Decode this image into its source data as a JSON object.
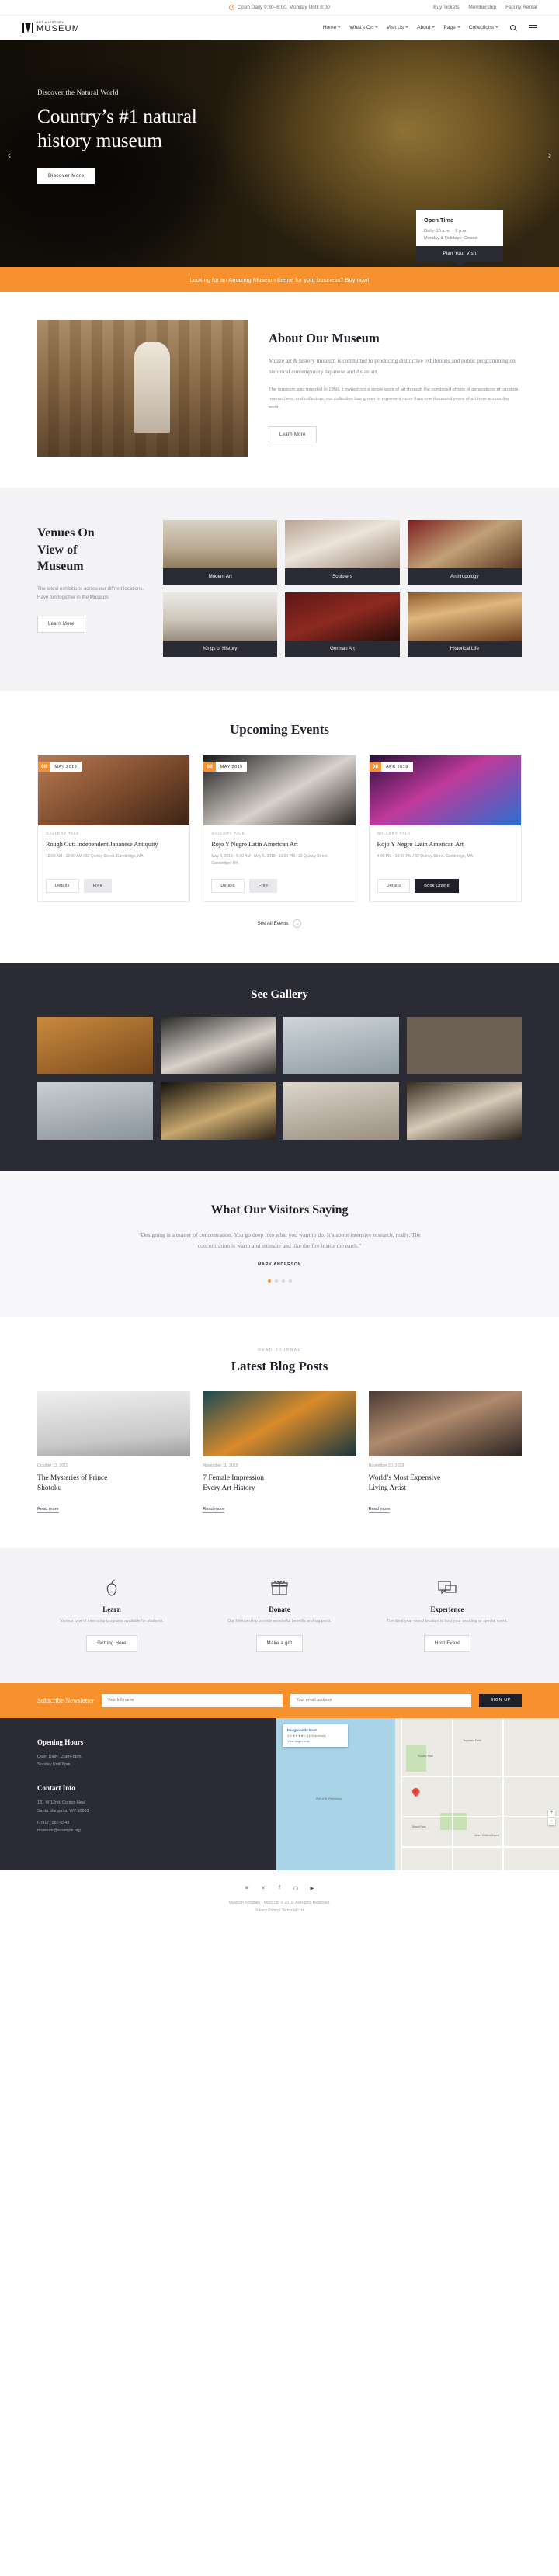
{
  "topbar": {
    "hours": "Open Daily 9:30–6:00, Monday Until 8:00",
    "links": [
      "Buy Tickets",
      "Membership",
      "Facility Rental"
    ]
  },
  "header": {
    "logo_sub": "ART & HISTORY",
    "logo_main": "MUSEUM",
    "nav": [
      "Home",
      "What's On",
      "Visit Us",
      "About",
      "Page",
      "Collections"
    ],
    "search_icon": "search-icon",
    "menu_icon": "hamburger-icon"
  },
  "hero": {
    "kicker": "Discover the Natural World",
    "title_line1": "Country’s #1 natural",
    "title_line2": "history museum",
    "cta": "Discover More",
    "prev_icon": "chevron-left-icon",
    "next_icon": "chevron-right-icon",
    "open_card": {
      "title": "Open Time",
      "line1": "Daily: 10 a.m. – 5 p.m.",
      "line2": "Monday & Holidays: Closed",
      "button": "Plan Your Visit"
    }
  },
  "promo": {
    "text": "Looking for an Amazing Museum theme for your business? Buy now!"
  },
  "about": {
    "heading": "About Our Museum",
    "lead": "Muzze art & history museum is committed to producing distinctive exhibitions and public programming on historical contemporary Japanese and Asian art.",
    "body": "The museum was founded in 1950, it owned not a single work of art through the combined efforts of generations of curators, researchers, and collectors, our collection has grown to represent more than one thousand years of art from across the world.",
    "button": "Learn More"
  },
  "venues": {
    "heading_line1": "Venues On",
    "heading_line2": "View of",
    "heading_line3": "Museum",
    "desc": "The latest exhibitions across our diffrent locations. Have fun together in the Museum.",
    "button": "Learn More",
    "cards": [
      {
        "label": "Modern Art"
      },
      {
        "label": "Sculpters"
      },
      {
        "label": "Anthropology"
      },
      {
        "label": "Kings of History"
      },
      {
        "label": "German Art"
      },
      {
        "label": "Historical Life"
      }
    ]
  },
  "events": {
    "heading": "Upcoming Events",
    "see_all": "See All Events",
    "see_all_icon": "arrow-right-icon",
    "items": [
      {
        "day": "08",
        "month": "MAY 2019",
        "category": "GALLERY TALK",
        "title": "Rough Cut: Independent Japanese Antiquity",
        "meta": "12:00 AM - 12:00 AM / 32 Quincy Street, Cambridge, MA",
        "btn1": "Details",
        "btn2": "Free",
        "btn2_style": "free"
      },
      {
        "day": "08",
        "month": "MAY 2019",
        "category": "GALLERY TALK",
        "title": "Rojo Y Negro Latin American Art",
        "meta": "May 8, 2019 - 5:00 AM - May 5, 2019 - 11:00 PM / 32 Quincy Street, Cambridge, MA",
        "btn1": "Details",
        "btn2": "Free",
        "btn2_style": "free"
      },
      {
        "day": "08",
        "month": "APR 2019",
        "category": "GALLERY TALK",
        "title": "Rojo Y Negro Latin American Art",
        "meta": "4:00 PM - 10:00 PM / 32 Quincy Street, Cambridge, MA",
        "btn1": "Details",
        "btn2": "Book Online",
        "btn2_style": "dark"
      }
    ]
  },
  "gallery": {
    "heading": "See Gallery",
    "cell_count": 8
  },
  "testimonial": {
    "heading": "What Our Visitors Saying",
    "quote": "“Designing is a matter of concentration. You go deep into what you want to do. It’s about intensive research, really. The concentration is warm and intimate and like the fire inside the earth.”",
    "author": "MARK ANDERSON",
    "dot_count": 4,
    "active_dot": 0
  },
  "blog": {
    "kicker": "READ JOURNAL",
    "heading": "Latest Blog Posts",
    "posts": [
      {
        "date": "October 13, 2019",
        "title_line1": "The Mysteries of Prince",
        "title_line2": "Shotoku",
        "more": "Read more"
      },
      {
        "date": "November 11, 2019",
        "title_line1": "7 Female Impression",
        "title_line2": "Every Art History",
        "more": "Read more"
      },
      {
        "date": "November 20, 2019",
        "title_line1": "World’s Most Expensive",
        "title_line2": "Living Artist",
        "more": "Read more"
      }
    ]
  },
  "features": [
    {
      "icon": "apple-icon",
      "title": "Learn",
      "desc": "Various type of internship programs available for students.",
      "button": "Getting Here"
    },
    {
      "icon": "gift-icon",
      "title": "Donate",
      "desc": "Our Membership provide wonderful benefits and supports.",
      "button": "Make a gift"
    },
    {
      "icon": "chat-icon",
      "title": "Experience",
      "desc": "The ideal year-round location to host your wedding or special event.",
      "button": "Host Event"
    }
  ],
  "newsletter": {
    "title": "Subscribe Newsletter",
    "name_placeholder": "Your full name",
    "email_placeholder": "Your email address",
    "button": "SIGN UP"
  },
  "footer": {
    "hours_title": "Opening Hours",
    "hours_lines": [
      "Open Daily, 10am–6pm.",
      "Sunday Until 8pm"
    ],
    "contact_title": "Contact Info",
    "contact_lines": [
      "131 W 12nd, Conton Heal",
      "Santa Margarita, WV 50663",
      "",
      "t. (917) 987-6543",
      "museum@example.org"
    ],
    "map": {
      "card_title": "Fairgrounds East",
      "card_sub": "4.5 ★★★★☆  (128 reviews)",
      "card_link": "View larger map",
      "labels": [
        "Port of St. Petersburg",
        "Pioneer Park",
        "Straub Park",
        "Albert Whitted Airport",
        "Tropicana Field",
        "Beach Dr NE",
        "Bayshore Dr"
      ]
    }
  },
  "bottom": {
    "social": [
      "twitter-icon",
      "vimeo-icon",
      "facebook-icon",
      "instagram-icon",
      "youtube-icon"
    ],
    "copyright": "Museum Template - Muzz Ltd © 2019. All Rights Reserved.",
    "links": [
      "Privacy Policy",
      "Terms of Use"
    ]
  }
}
